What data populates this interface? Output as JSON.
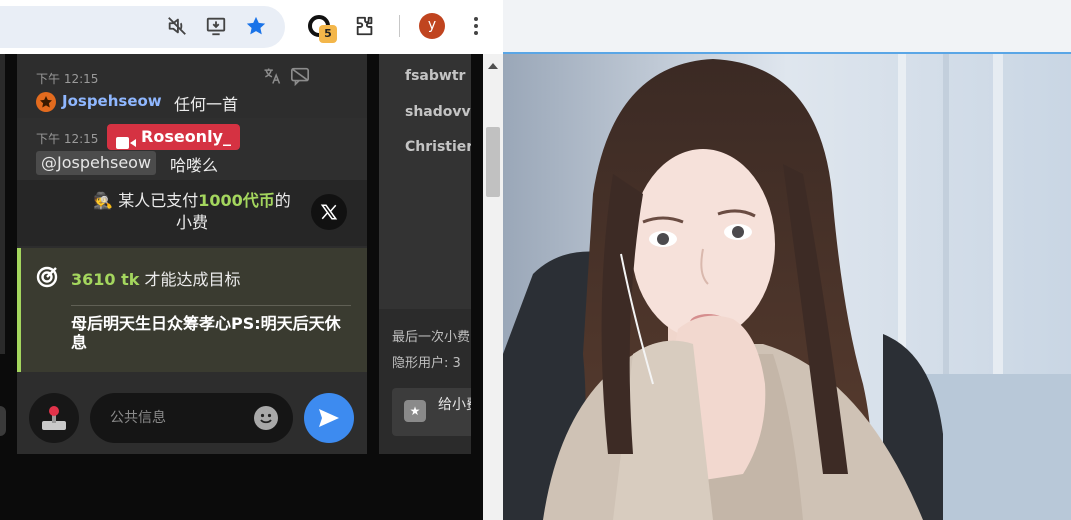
{
  "browser": {
    "profile_initial": "y",
    "extension_badge_count": "5",
    "icons": [
      "mute-tab-icon",
      "install-app-icon",
      "bookmark-star-icon",
      "extension-icon",
      "puzzle-extensions-icon",
      "more-menu-icon"
    ],
    "accent_color": "#1a73e8"
  },
  "chat": {
    "messages": [
      {
        "time": "下午 12:15",
        "user": "Jospehseow",
        "text": "任何一首"
      },
      {
        "time": "下午 12:15",
        "user": "Roseonly_",
        "mention": "@Jospehseow",
        "text": "哈喽么"
      }
    ],
    "tip": {
      "prefix": "某人已支付",
      "amount": "1000代币",
      "suffix": "的小费"
    },
    "goal": {
      "tokens": "3610 tk",
      "text": "才能达成目标",
      "description": "母后明天生日众筹孝心PS:明天后天休息"
    },
    "input": {
      "placeholder": "公共信息"
    },
    "colors": {
      "highlight_green": "#a4d65e",
      "broadcaster_red": "#d53242",
      "send_blue": "#3d8bf0"
    }
  },
  "users_panel": {
    "names": [
      "fsabwtr |",
      "shadovv",
      "Christier"
    ],
    "last_tip_label": "最后一次小费",
    "hidden_users_label": "隐形用户: 3",
    "gift_label": "给小费"
  }
}
